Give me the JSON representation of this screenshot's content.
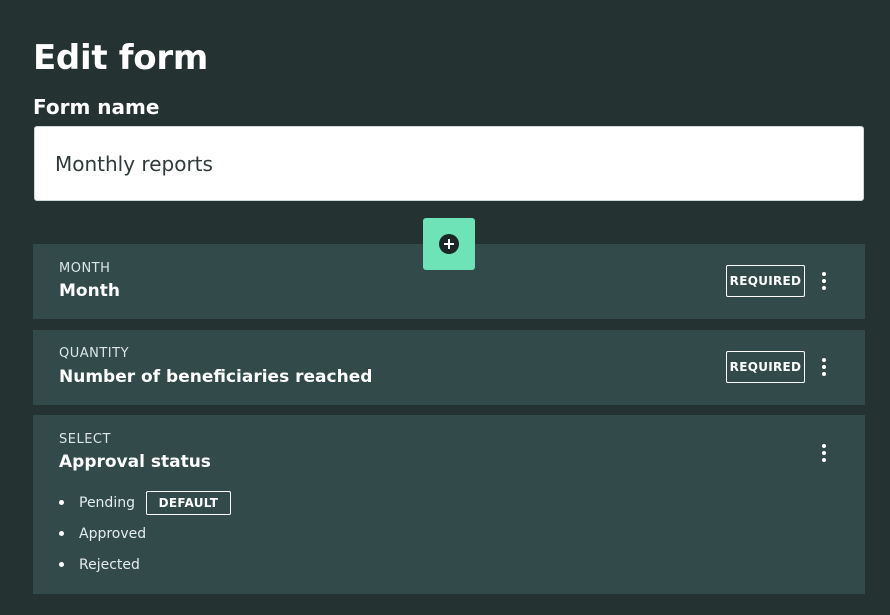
{
  "page": {
    "title": "Edit form",
    "form_name_label": "Form name",
    "form_name_value": "Monthly reports"
  },
  "add_button": {
    "icon": "plus-circle-icon"
  },
  "fields": [
    {
      "type": "MONTH",
      "label": "Month",
      "badge": "REQUIRED"
    },
    {
      "type": "QUANTITY",
      "label": "Number of beneficiaries reached",
      "badge": "REQUIRED"
    },
    {
      "type": "SELECT",
      "label": "Approval status",
      "options": [
        {
          "label": "Pending",
          "badge": "DEFAULT"
        },
        {
          "label": "Approved"
        },
        {
          "label": "Rejected"
        }
      ]
    }
  ],
  "colors": {
    "background": "#243232",
    "card": "#334a4a",
    "accent": "#6fe3b8"
  }
}
